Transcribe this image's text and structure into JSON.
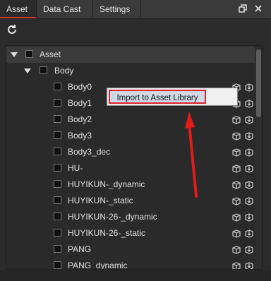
{
  "tabs": [
    {
      "label": "Asset",
      "active": true
    },
    {
      "label": "Data Cast",
      "active": false
    },
    {
      "label": "Settings",
      "active": false
    }
  ],
  "window_buttons": {
    "restore_icon": "restore-icon",
    "close_icon": "close-icon"
  },
  "toolbar": {
    "refresh_icon": "refresh-icon"
  },
  "tree": {
    "root": {
      "label": "Asset"
    },
    "body": {
      "label": "Body"
    },
    "items": [
      {
        "label": "Body0"
      },
      {
        "label": "Body1"
      },
      {
        "label": "Body2"
      },
      {
        "label": "Body3"
      },
      {
        "label": "Body3_dec"
      },
      {
        "label": "HU-"
      },
      {
        "label": "HUYIKUN-_dynamic"
      },
      {
        "label": "HUYIKUN-_static"
      },
      {
        "label": "HUYIKUN-26-_dynamic"
      },
      {
        "label": "HUYIKUN-26-_static"
      },
      {
        "label": "PANG"
      },
      {
        "label": "PANG_dynamic"
      }
    ],
    "row_icons": [
      "asset-icon",
      "asset-import-icon"
    ]
  },
  "context_menu": {
    "item_label": "Import to Asset Library"
  },
  "bottom_partial_text": "",
  "colors": {
    "accent": "#e3232c",
    "menu_bg": "#f0f0f0",
    "panel_bg": "#2a2a2a"
  }
}
